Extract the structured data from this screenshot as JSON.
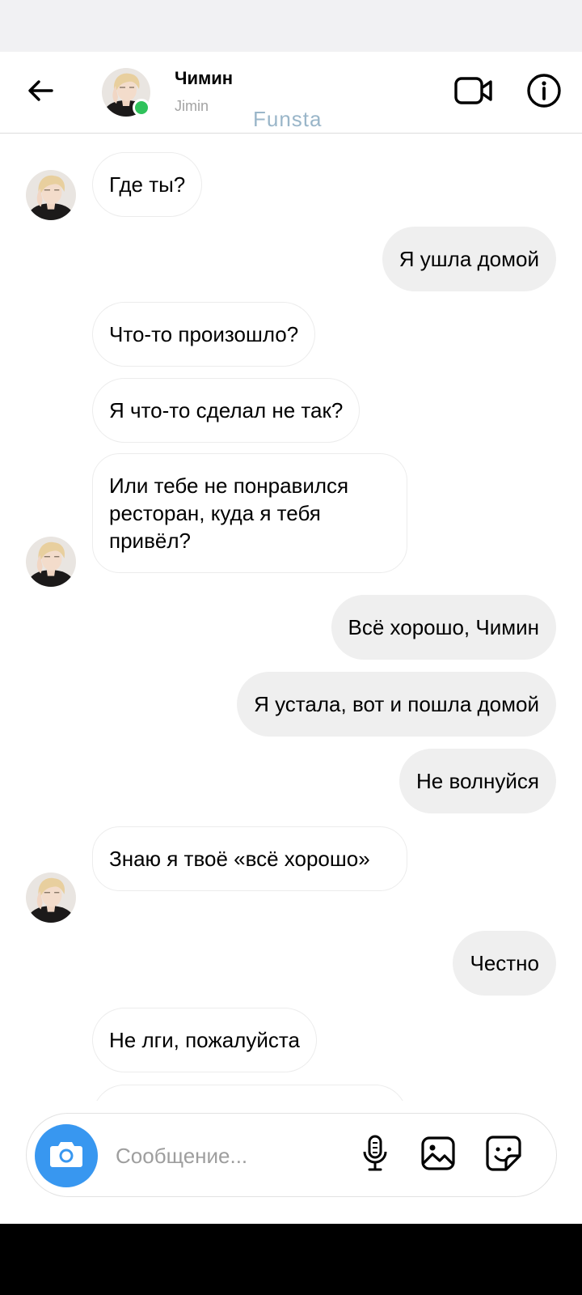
{
  "header": {
    "contact_name": "Чимин",
    "contact_username": "Jimin",
    "watermark": "Funsta"
  },
  "messages": [
    {
      "side": "in",
      "text": "Где ты?"
    },
    {
      "side": "out",
      "text": "Я ушла домой"
    },
    {
      "side": "in",
      "text": "Что-то произошло?"
    },
    {
      "side": "in",
      "text": "Я что-то сделал не так?"
    },
    {
      "side": "in",
      "text": "Или тебе не понравился ресторан, куда я тебя привёл?"
    },
    {
      "side": "out",
      "text": "Всё хорошо, Чимин"
    },
    {
      "side": "out",
      "text": "Я устала, вот и пошла домой"
    },
    {
      "side": "out",
      "text": "Не волнуйся"
    },
    {
      "side": "in",
      "text": "Знаю я твоё «всё хорошо»"
    },
    {
      "side": "out",
      "text": "Честно"
    },
    {
      "side": "in",
      "text": "Не лги, пожалуйста"
    },
    {
      "side": "in",
      "text": ""
    }
  ],
  "composer": {
    "placeholder": "Сообщение..."
  },
  "icons": {
    "back": "arrow-left-icon",
    "video": "video-camera-icon",
    "info": "info-icon",
    "camera": "camera-icon",
    "mic": "microphone-icon",
    "gallery": "image-icon",
    "sticker": "sticker-icon"
  },
  "colors": {
    "online": "#2fc25b",
    "camera_button": "#3897f0",
    "outgoing_bubble": "#efefef",
    "watermark": "#9ab6c9"
  }
}
